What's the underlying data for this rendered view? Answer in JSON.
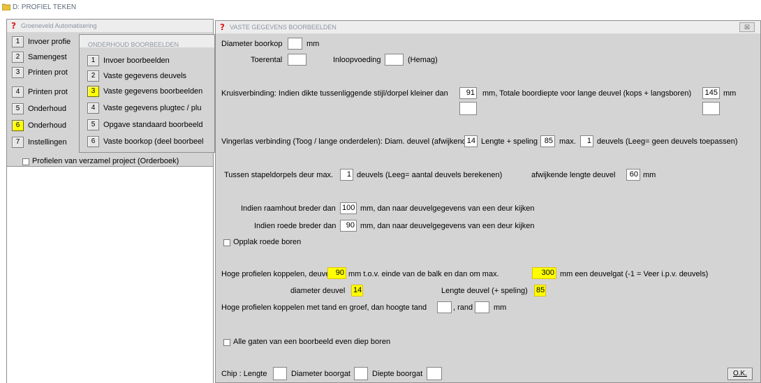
{
  "app": {
    "title": "D: PROFIEL TEKEN"
  },
  "main_window": {
    "title": "Groeneveld Automatisering",
    "items": [
      {
        "num": "1",
        "label": "Invoer profie"
      },
      {
        "num": "2",
        "label": "Samengest"
      },
      {
        "num": "3",
        "label": "Printen prot"
      },
      {
        "num": "4",
        "label": "Printen prot"
      },
      {
        "num": "5",
        "label": "Onderhoud"
      },
      {
        "num": "6",
        "label": "Onderhoud"
      },
      {
        "num": "7",
        "label": "Instellingen"
      }
    ],
    "checkbox_label": "Profielen van verzamel project (Orderboek)"
  },
  "sub_window": {
    "title": "ONDERHOUD BOORBEELDEN",
    "items": [
      {
        "num": "1",
        "label": "Invoer boorbeelden"
      },
      {
        "num": "2",
        "label": "Vaste gegevens deuvels"
      },
      {
        "num": "3",
        "label": "Vaste gegevens boorbeelden"
      },
      {
        "num": "4",
        "label": "Vaste gegevens plugtec / plu"
      },
      {
        "num": "5",
        "label": "Opgave standaard boorbeeld"
      },
      {
        "num": "6",
        "label": "Vaste boorkop (deel boorbeel"
      }
    ]
  },
  "dialog": {
    "title": "VASTE GEGEVENS BOORBEELDEN",
    "close": "☒",
    "diameter_boorkop": {
      "label": "Diameter boorkop",
      "value": "",
      "unit": "mm"
    },
    "toerental": {
      "label": "Toerental",
      "value": ""
    },
    "inloopvoeding": {
      "label": "Inloopvoeding",
      "value": "",
      "suffix": "(Hemag)"
    },
    "kruis": {
      "label": "Kruisverbinding: Indien dikte tussenliggende stijl/dorpel kleiner dan",
      "value": "91",
      "mid": "mm, Totale boordiepte voor lange deuvel (kops + langsboren)",
      "value2": "145",
      "unit": "mm",
      "extra1": "",
      "extra2": ""
    },
    "vinger": {
      "label": "Vingerlas verbinding (Toog / lange onderdelen): Diam. deuvel (afwijkend)",
      "diam": "14",
      "lengte_label": "Lengte + speling",
      "lengte": "85",
      "max_label": "max.",
      "max": "1",
      "suffix": "deuvels (Leeg= geen deuvels toepassen)"
    },
    "stapel": {
      "label": "Tussen stapeldorpels deur max.",
      "value": "1",
      "suffix": "deuvels (Leeg= aantal deuvels berekenen)",
      "afw_label": "afwijkende lengte deuvel",
      "afw": "60",
      "unit": "mm"
    },
    "raamhout": {
      "label": "Indien raamhout breder dan",
      "value": "100",
      "suffix": "mm, dan naar deuvelgegevens van een deur kijken"
    },
    "roede": {
      "label": "Indien roede breder dan",
      "value": "90",
      "suffix": "mm, dan naar deuvelgegevens van een deur kijken"
    },
    "opplak": {
      "label": "Opplak roede boren"
    },
    "hoge": {
      "label": "Hoge profielen koppelen, deuvelgat",
      "value": "90",
      "mid": "mm t.o.v. einde van de balk   en dan om max.",
      "value2": "300",
      "suffix": "mm een deuvelgat (-1 = Veer i.p.v. deuvels)",
      "diam_label": "diameter deuvel",
      "diam": "14",
      "lengte_label": "Lengte deuvel (+ speling)",
      "lengte": "85"
    },
    "tand": {
      "label": "Hoge profielen koppelen met tand en groef, dan hoogte tand",
      "value": "",
      "rand_label": ", rand",
      "rand": "",
      "unit": "mm"
    },
    "gaten": {
      "label": "Alle gaten van een boorbeeld even diep boren"
    },
    "chip": {
      "label": "Chip : Lengte",
      "value": "",
      "diam_label": "Diameter boorgat",
      "diam": "",
      "diepte_label": "Diepte boorgat",
      "diepte": ""
    },
    "ok_label": "O.K."
  }
}
